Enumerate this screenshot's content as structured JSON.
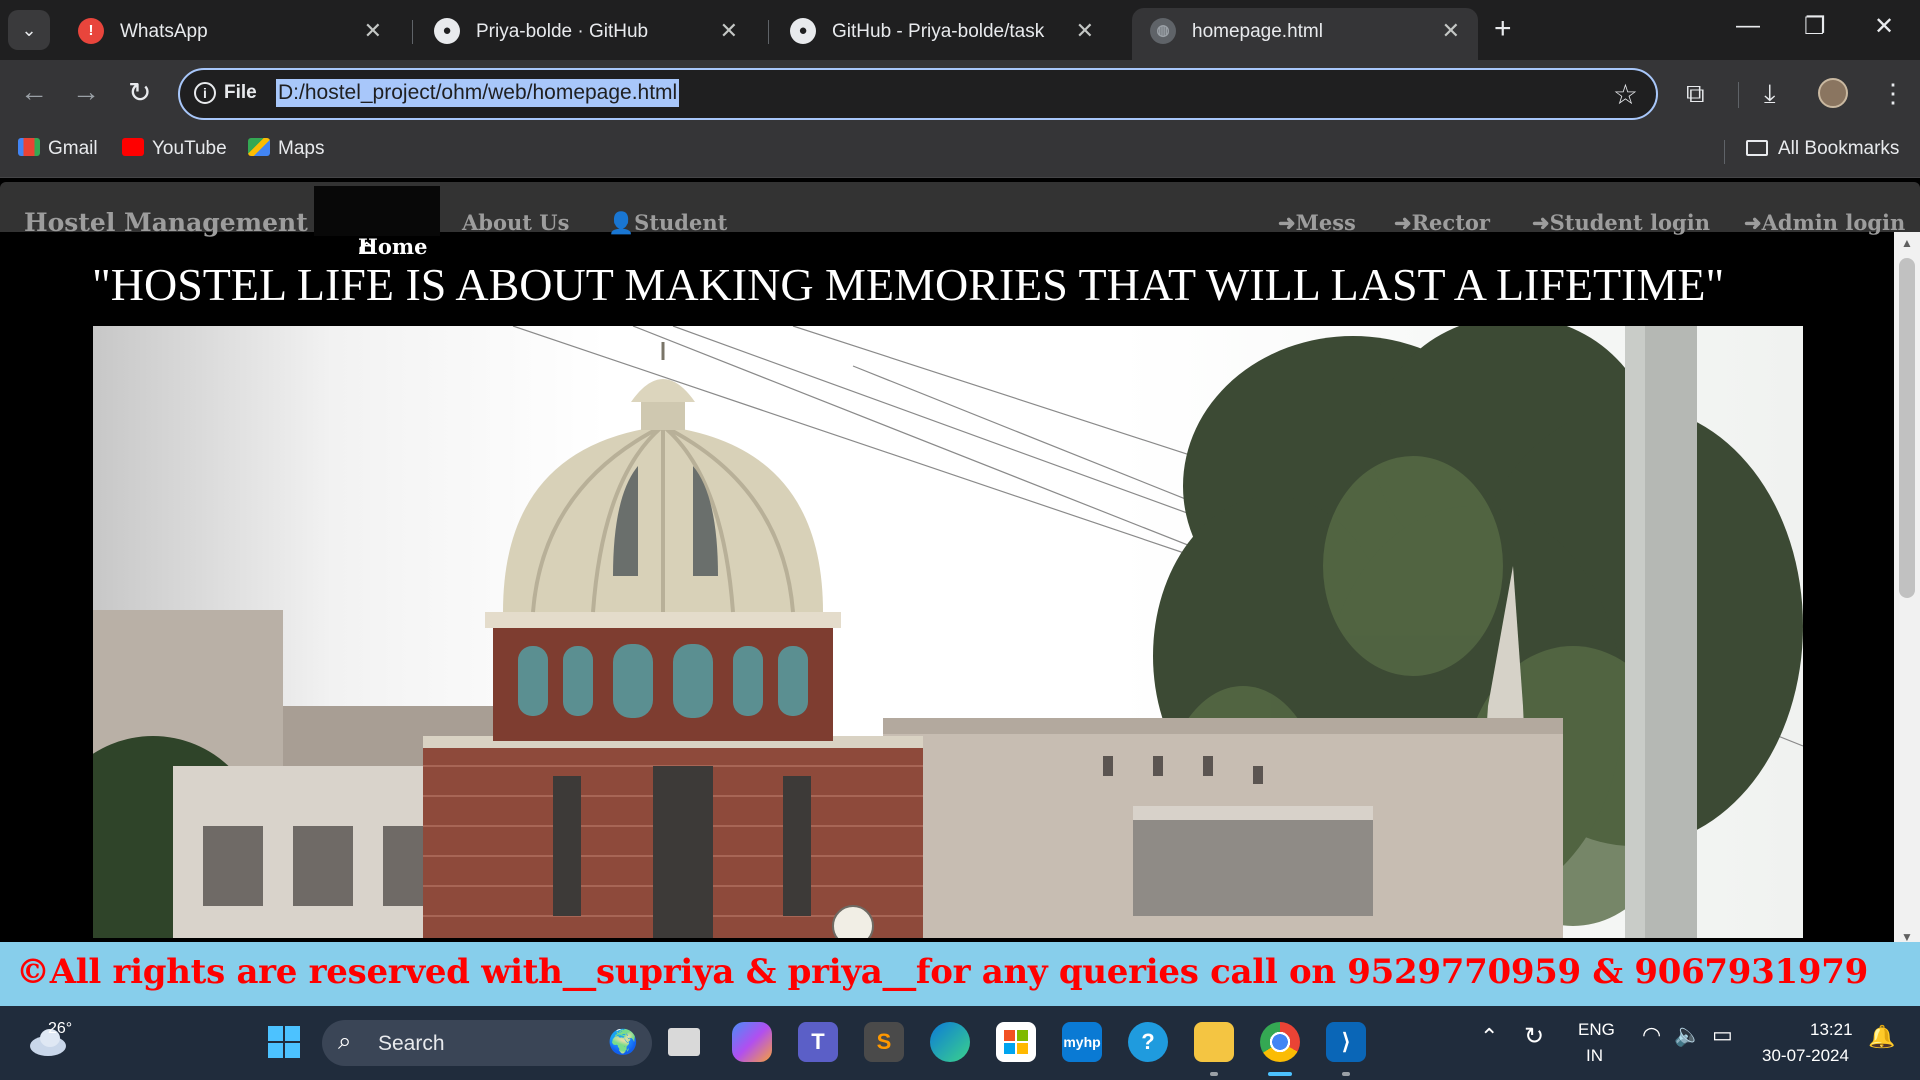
{
  "browser": {
    "tabs": [
      {
        "title": "WhatsApp",
        "icon": "whatsapp-alert-icon"
      },
      {
        "title": "Priya-bolde · GitHub",
        "icon": "github-icon"
      },
      {
        "title": "GitHub - Priya-bolde/task",
        "icon": "github-icon"
      },
      {
        "title": "homepage.html",
        "icon": "globe-icon"
      }
    ],
    "active_tab": 3,
    "omnibox": {
      "scheme_label": "File",
      "url": "D:/hostel_project/ohm/web/homepage.html"
    },
    "bookmarks": [
      {
        "label": "Gmail",
        "icon": "gmail-icon"
      },
      {
        "label": "YouTube",
        "icon": "youtube-icon"
      },
      {
        "label": "Maps",
        "icon": "maps-icon"
      }
    ],
    "all_bookmarks_label": "All Bookmarks"
  },
  "site": {
    "brand": "Hostel Management",
    "nav_left": [
      {
        "label": "Home",
        "icon": "home-icon"
      },
      {
        "label": "About Us"
      },
      {
        "label": "Student",
        "icon": "user-icon"
      }
    ],
    "nav_right": [
      {
        "label": "Mess",
        "icon": "login-icon"
      },
      {
        "label": "Rector",
        "icon": "login-icon"
      },
      {
        "label": "Student login",
        "icon": "login-icon"
      },
      {
        "label": "Admin login",
        "icon": "login-icon"
      }
    ],
    "quote": "\"HOSTEL LIFE IS ABOUT MAKING MEMORIES THAT WILL LAST A LIFETIME\"",
    "footer": "©All rights are reserved with__supriya & priya__for any queries call on 9529770959 & 9067931979",
    "colors": {
      "nav_bg": "#333333",
      "footer_bg": "#87ceeb",
      "footer_text": "#ff0000"
    }
  },
  "taskbar": {
    "weather_temp": "26°",
    "search_label": "Search",
    "lang_line1": "ENG",
    "lang_line2": "IN",
    "time": "13:21",
    "date": "30-07-2024"
  }
}
